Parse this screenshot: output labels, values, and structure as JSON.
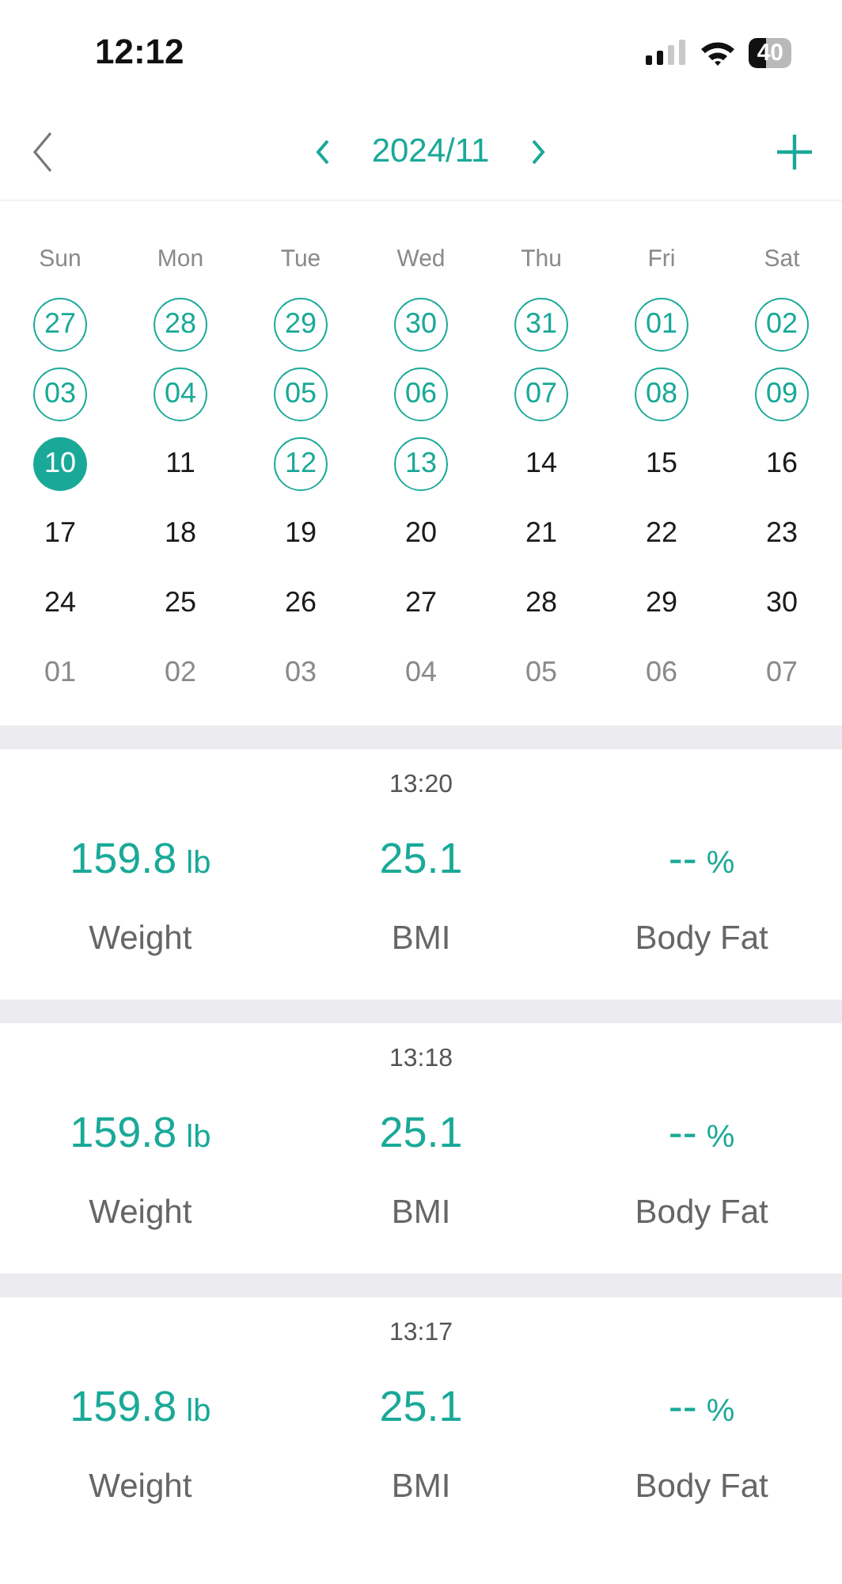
{
  "status_bar": {
    "time": "12:12",
    "battery": "40"
  },
  "header": {
    "month": "2024/11"
  },
  "calendar": {
    "weekdays": [
      "Sun",
      "Mon",
      "Tue",
      "Wed",
      "Thu",
      "Fri",
      "Sat"
    ],
    "days": [
      {
        "day": "27",
        "recorded": true,
        "selected": false,
        "muted": false
      },
      {
        "day": "28",
        "recorded": true,
        "selected": false,
        "muted": false
      },
      {
        "day": "29",
        "recorded": true,
        "selected": false,
        "muted": false
      },
      {
        "day": "30",
        "recorded": true,
        "selected": false,
        "muted": false
      },
      {
        "day": "31",
        "recorded": true,
        "selected": false,
        "muted": false
      },
      {
        "day": "01",
        "recorded": true,
        "selected": false,
        "muted": false
      },
      {
        "day": "02",
        "recorded": true,
        "selected": false,
        "muted": false
      },
      {
        "day": "03",
        "recorded": true,
        "selected": false,
        "muted": false
      },
      {
        "day": "04",
        "recorded": true,
        "selected": false,
        "muted": false
      },
      {
        "day": "05",
        "recorded": true,
        "selected": false,
        "muted": false
      },
      {
        "day": "06",
        "recorded": true,
        "selected": false,
        "muted": false
      },
      {
        "day": "07",
        "recorded": true,
        "selected": false,
        "muted": false
      },
      {
        "day": "08",
        "recorded": true,
        "selected": false,
        "muted": false
      },
      {
        "day": "09",
        "recorded": true,
        "selected": false,
        "muted": false
      },
      {
        "day": "10",
        "recorded": true,
        "selected": true,
        "muted": false
      },
      {
        "day": "11",
        "recorded": false,
        "selected": false,
        "muted": false
      },
      {
        "day": "12",
        "recorded": true,
        "selected": false,
        "muted": false
      },
      {
        "day": "13",
        "recorded": true,
        "selected": false,
        "muted": false
      },
      {
        "day": "14",
        "recorded": false,
        "selected": false,
        "muted": false
      },
      {
        "day": "15",
        "recorded": false,
        "selected": false,
        "muted": false
      },
      {
        "day": "16",
        "recorded": false,
        "selected": false,
        "muted": false
      },
      {
        "day": "17",
        "recorded": false,
        "selected": false,
        "muted": false
      },
      {
        "day": "18",
        "recorded": false,
        "selected": false,
        "muted": false
      },
      {
        "day": "19",
        "recorded": false,
        "selected": false,
        "muted": false
      },
      {
        "day": "20",
        "recorded": false,
        "selected": false,
        "muted": false
      },
      {
        "day": "21",
        "recorded": false,
        "selected": false,
        "muted": false
      },
      {
        "day": "22",
        "recorded": false,
        "selected": false,
        "muted": false
      },
      {
        "day": "23",
        "recorded": false,
        "selected": false,
        "muted": false
      },
      {
        "day": "24",
        "recorded": false,
        "selected": false,
        "muted": false
      },
      {
        "day": "25",
        "recorded": false,
        "selected": false,
        "muted": false
      },
      {
        "day": "26",
        "recorded": false,
        "selected": false,
        "muted": false
      },
      {
        "day": "27",
        "recorded": false,
        "selected": false,
        "muted": false
      },
      {
        "day": "28",
        "recorded": false,
        "selected": false,
        "muted": false
      },
      {
        "day": "29",
        "recorded": false,
        "selected": false,
        "muted": false
      },
      {
        "day": "30",
        "recorded": false,
        "selected": false,
        "muted": false
      },
      {
        "day": "01",
        "recorded": false,
        "selected": false,
        "muted": true
      },
      {
        "day": "02",
        "recorded": false,
        "selected": false,
        "muted": true
      },
      {
        "day": "03",
        "recorded": false,
        "selected": false,
        "muted": true
      },
      {
        "day": "04",
        "recorded": false,
        "selected": false,
        "muted": true
      },
      {
        "day": "05",
        "recorded": false,
        "selected": false,
        "muted": true
      },
      {
        "day": "06",
        "recorded": false,
        "selected": false,
        "muted": true
      },
      {
        "day": "07",
        "recorded": false,
        "selected": false,
        "muted": true
      }
    ]
  },
  "records": [
    {
      "time": "13:20",
      "metrics": [
        {
          "value": "159.8",
          "unit": "lb",
          "label": "Weight"
        },
        {
          "value": "25.1",
          "label": "BMI"
        },
        {
          "value": "--",
          "unit": "%",
          "label": "Body Fat"
        }
      ]
    },
    {
      "time": "13:18",
      "metrics": [
        {
          "value": "159.8",
          "unit": "lb",
          "label": "Weight"
        },
        {
          "value": "25.1",
          "label": "BMI"
        },
        {
          "value": "--",
          "unit": "%",
          "label": "Body Fat"
        }
      ]
    },
    {
      "time": "13:17",
      "metrics": [
        {
          "value": "159.8",
          "unit": "lb",
          "label": "Weight"
        },
        {
          "value": "25.1",
          "label": "BMI"
        },
        {
          "value": "--",
          "unit": "%",
          "label": "Body Fat"
        }
      ]
    }
  ]
}
